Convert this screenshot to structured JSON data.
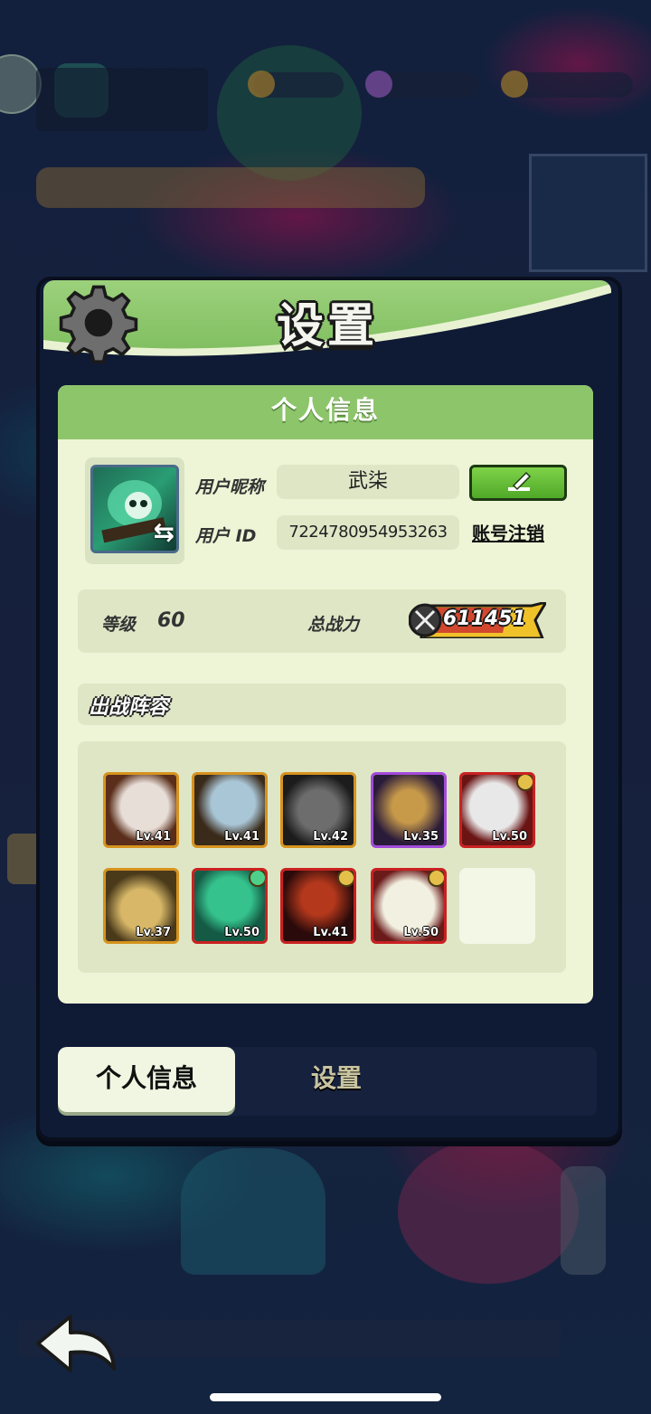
{
  "modal": {
    "title": "设置",
    "section_title": "个人信息"
  },
  "profile": {
    "nickname_label": "用户昵称",
    "nickname": "武柒",
    "id_label": "用户 ID",
    "user_id": "7224780954953263",
    "cancel_account": "账号注销",
    "level_label": "等级",
    "level": "60",
    "power_label": "总战力",
    "power": "611451"
  },
  "lineup": {
    "title": "出战阵容",
    "heroes": [
      {
        "level": "Lv.41",
        "rarity_color": "#d6931e",
        "art": [
          "#5a2e1a",
          "#e8ded8"
        ]
      },
      {
        "level": "Lv.41",
        "rarity_color": "#d6931e",
        "art": [
          "#3a2a1a",
          "#a9c6d6"
        ]
      },
      {
        "level": "Lv.42",
        "rarity_color": "#d6931e",
        "art": [
          "#1c1c1c",
          "#6d6d6d"
        ]
      },
      {
        "level": "Lv.35",
        "rarity_color": "#a24bd9",
        "art": [
          "#2a1b3a",
          "#c79a4a"
        ]
      },
      {
        "level": "Lv.50",
        "rarity_color": "#c92121",
        "art": [
          "#6a1414",
          "#e8e8e8"
        ]
      },
      {
        "level": "Lv.37",
        "rarity_color": "#d6931e",
        "art": [
          "#4a3a1a",
          "#d8b868"
        ]
      },
      {
        "level": "Lv.50",
        "rarity_color": "#c92121",
        "art": [
          "#145a44",
          "#35c28d"
        ]
      },
      {
        "level": "Lv.41",
        "rarity_color": "#c92121",
        "art": [
          "#2a0a0a",
          "#b4381c"
        ]
      },
      {
        "level": "Lv.50",
        "rarity_color": "#c92121",
        "art": [
          "#6b1a1a",
          "#f2f0e0"
        ]
      }
    ]
  },
  "tabs": {
    "profile": "个人信息",
    "settings": "设置"
  },
  "colors": {
    "header_green": "#8dc56b",
    "panel_bg": "#edf5d6",
    "power_badge": "#f0c22a"
  },
  "icons": {
    "header": "gear-icon",
    "edit": "pencil-icon",
    "swap": "swap-arrows-icon",
    "power": "crossed-swords-icon",
    "back": "back-arrow-icon"
  }
}
